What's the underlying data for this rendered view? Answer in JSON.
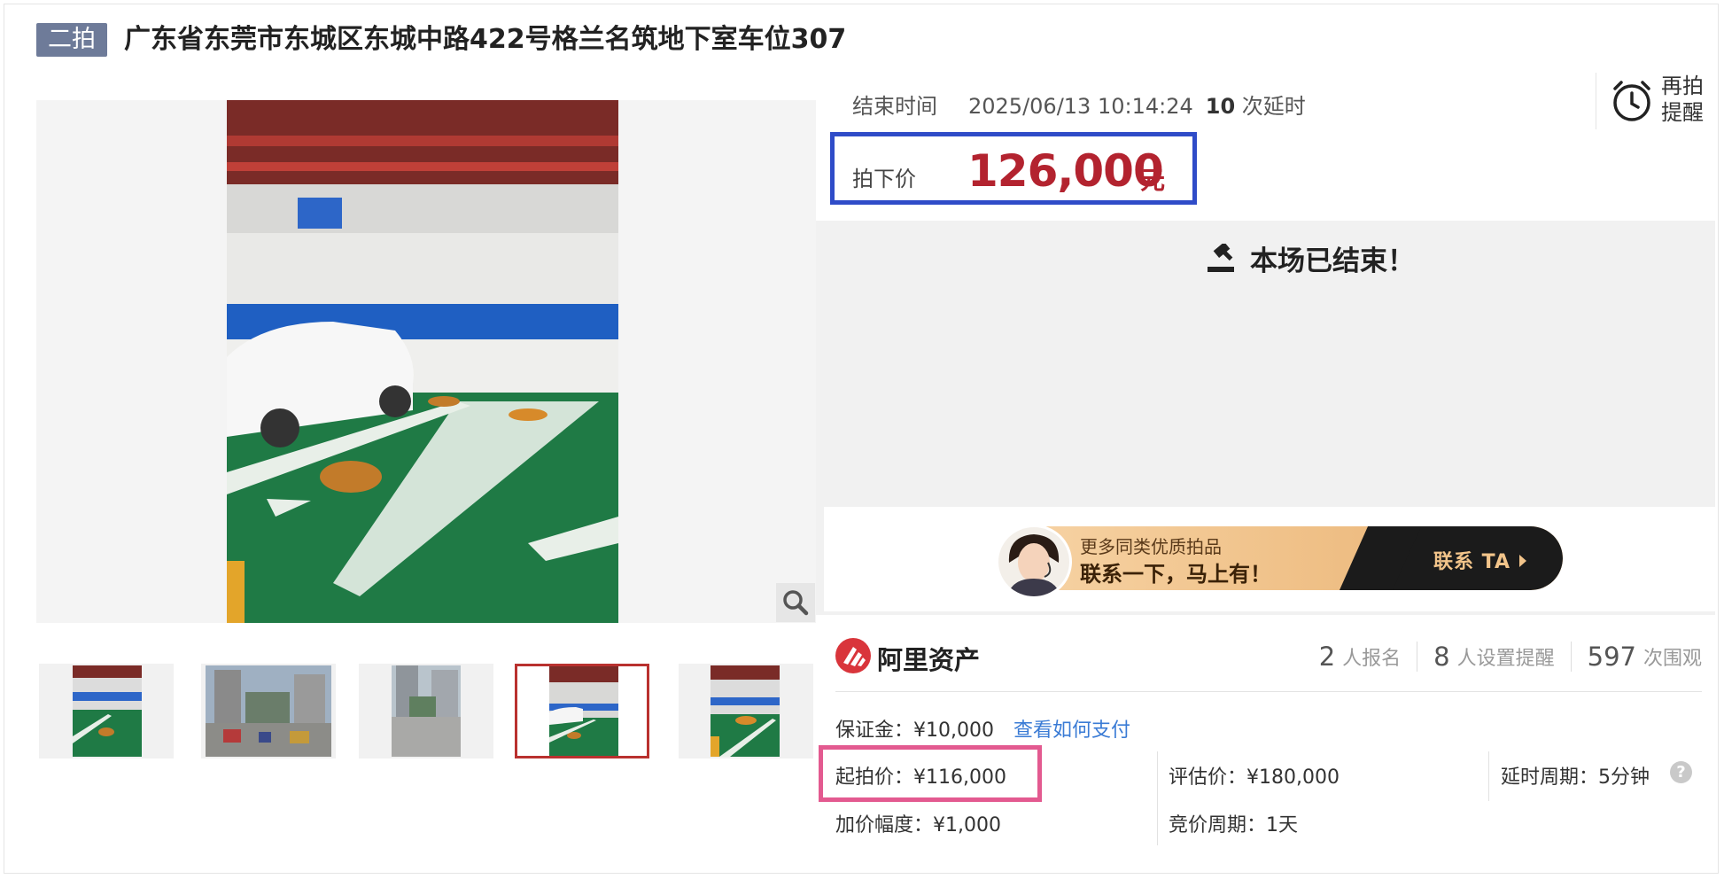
{
  "header": {
    "round_badge": "二拍",
    "title": "广东省东莞市东城区东城中路422号格兰名筑地下室车位307"
  },
  "auction": {
    "end_label": "结束时间",
    "end_time": "2025/06/13 10:14:24",
    "delay_count": "10",
    "delay_suffix": "次延时",
    "remind_line1": "再拍",
    "remind_line2": "提醒",
    "deal_label": "拍下价",
    "deal_price": "126,000",
    "deal_unit": "元",
    "ended_text": "本场已结束！"
  },
  "promo": {
    "small_text": "更多同类优质拍品",
    "big_text": "联系一下，马上有！",
    "button": "联系 TA"
  },
  "platform": {
    "name": "阿里资产"
  },
  "stats": [
    {
      "num": "2",
      "label": "人报名"
    },
    {
      "num": "8",
      "label": "人设置提醒"
    },
    {
      "num": "597",
      "label": "次围观"
    }
  ],
  "details": {
    "deposit": "保证金：¥10,000",
    "pay_link": "查看如何支付",
    "start_price": "起拍价：¥116,000",
    "assessed": "评估价：¥180,000",
    "delay_period": "延时周期：5分钟",
    "increment": "加价幅度：¥1,000",
    "bid_period": "竞价周期：1天"
  },
  "icons": {
    "zoom": "magnifier-icon",
    "alarm": "alarm-clock-icon",
    "gavel": "gavel-icon",
    "help": "question-icon"
  },
  "colors": {
    "deal_price": "#b3232f",
    "deal_box_border": "#2f4cc8",
    "start_price_border": "#e35a90",
    "round_badge": "#6e7b99",
    "link": "#3a7bd5"
  }
}
